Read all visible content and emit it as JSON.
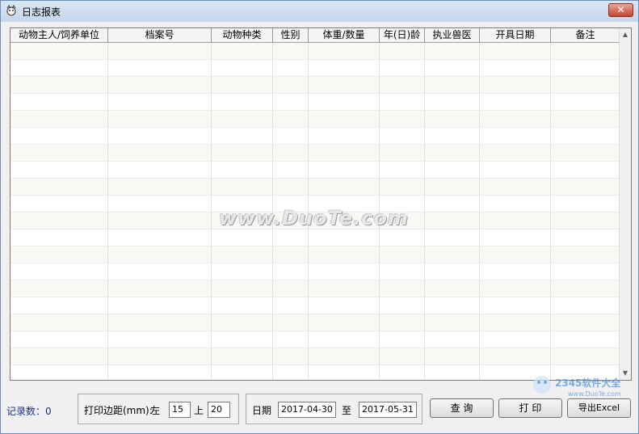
{
  "window": {
    "title": "日志报表",
    "close_label": "✕"
  },
  "table": {
    "columns": [
      "动物主人/饲养单位",
      "档案号",
      "动物种类",
      "性别",
      "体重/数量",
      "年(日)龄",
      "执业兽医",
      "开具日期",
      "备注"
    ],
    "rows": []
  },
  "watermark": "www.DuoTe.com",
  "status": {
    "record_count_label": "记录数：0"
  },
  "margins": {
    "group_label": "打印边距(mm):",
    "left_label": "左",
    "left_value": "15",
    "top_label": "上",
    "top_value": "20"
  },
  "date_range": {
    "label": "日期",
    "from": "2017-04-30",
    "to_label": "至",
    "to": "2017-05-31"
  },
  "buttons": {
    "query": "查 询",
    "print": "打 印",
    "export": "导出Excel"
  },
  "corner_logo": {
    "text": "2345软件大全",
    "url": "www.DuoTe.com"
  },
  "colors": {
    "title_gradient_top": "#d9e6f4",
    "close_red": "#c7432f",
    "record_label": "#1a2f8a"
  }
}
